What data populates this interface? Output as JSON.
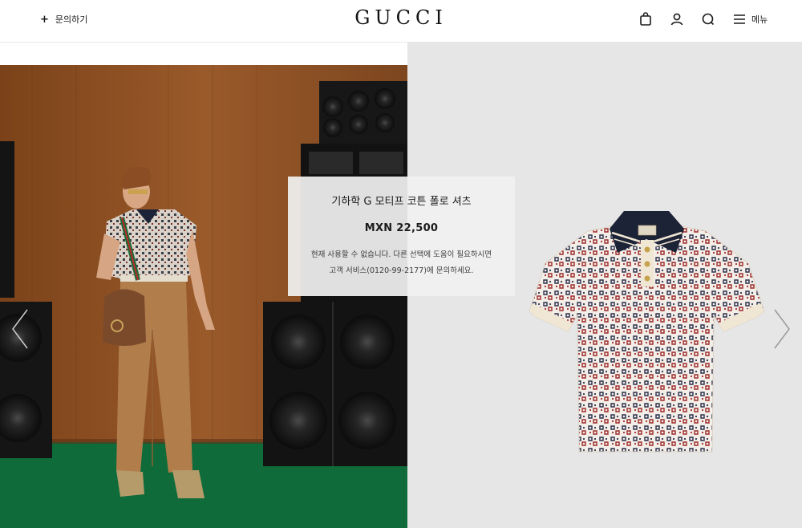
{
  "header": {
    "contact_label": "문의하기",
    "brand": "GUCCI",
    "menu_label": "메뉴",
    "icons": [
      "plus-icon",
      "shopping-bag-icon",
      "account-icon",
      "search-icon",
      "hamburger-menu-icon"
    ]
  },
  "product": {
    "name": "기하학 G 모티프 코튼 폴로 셔츠",
    "price": "MXN 22,500",
    "availability_line1": "현재 사용할 수 없습니다. 다른 선택에 도움이 필요하시면",
    "availability_line2": "고객 서비스(0120-99-2177)에 문의하세요."
  },
  "carousel": {
    "prev_icon": "chevron-left-icon",
    "next_icon": "chevron-right-icon"
  },
  "colors": {
    "wood_wall": "#8a4d22",
    "floor_green": "#0f6b3a",
    "panel_gray": "#e6e6e6",
    "polo_collar": "#1d2336",
    "polo_trim": "#efe6d3",
    "pattern_red": "#9c2a2a"
  }
}
